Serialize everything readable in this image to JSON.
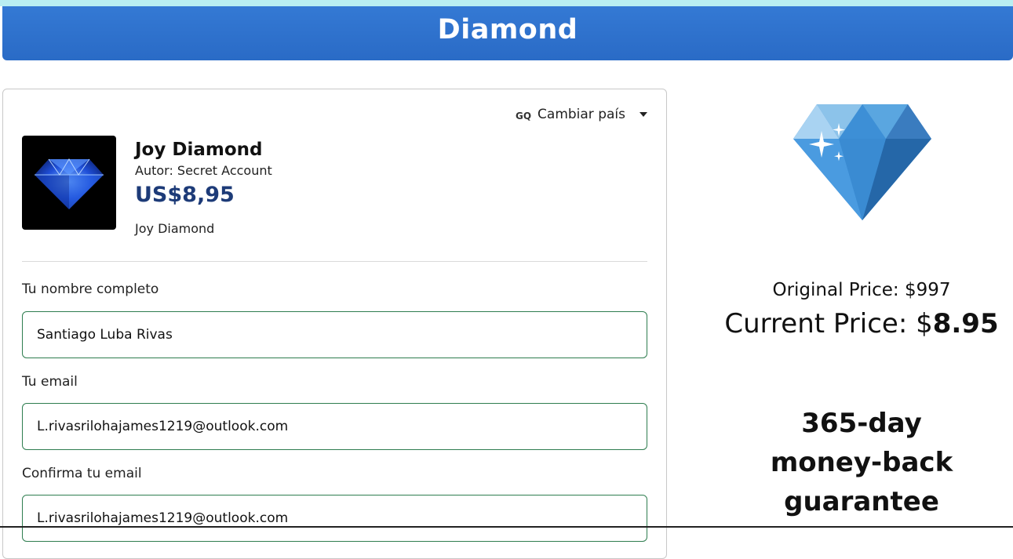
{
  "header": {
    "title": "Diamond"
  },
  "country": {
    "code": "GQ",
    "label": "Cambiar país"
  },
  "product": {
    "name": "Joy Diamond",
    "author": "Autor: Secret Account",
    "price": "US$8,95",
    "description": "Joy Diamond",
    "thumbnail_icon": "blue-diamond-image"
  },
  "form": {
    "fullname_label": "Tu nombre completo",
    "fullname_value": "Santiago Luba Rivas",
    "email_label": "Tu email",
    "email_value": "L.rivasrilohajames1219@outlook.com",
    "confirm_label": "Confirma tu email",
    "confirm_value": "L.rivasrilohajames1219@outlook.com"
  },
  "side": {
    "diamond_icon": "diamond-icon",
    "original_price": "Original Price: $997",
    "current_price_label": "Current Price: $",
    "current_price_value": "8.95",
    "guarantee": "365-day money-back guarantee"
  },
  "colors": {
    "header_blue": "#3479d4",
    "price_navy": "#1d3b78",
    "input_border_green": "#2e7d4f",
    "top_strip": "#b9eef2"
  }
}
